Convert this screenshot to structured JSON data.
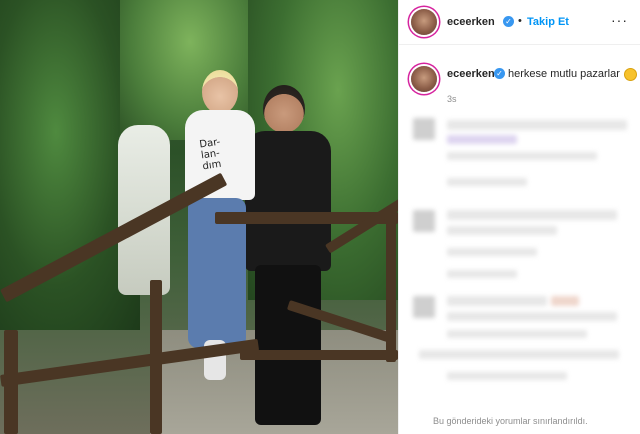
{
  "post": {
    "username": "eceerken",
    "follow_label": "Takip Et",
    "separator": "•",
    "more_label": "···",
    "verified_mark": "✓",
    "caption_text": "herkese mutlu pazarlar",
    "caption_emoji": "smiling-face-emoji",
    "time": "3s",
    "comments_limited_text": "Bu gönderideki yorumlar sınırlandırıldı.",
    "shirt_text": "Dar-\nlan-\ndım"
  },
  "colors": {
    "accent": "#0095f6",
    "verified": "#3897f0",
    "text": "#262626",
    "muted": "#8e8e8e"
  }
}
